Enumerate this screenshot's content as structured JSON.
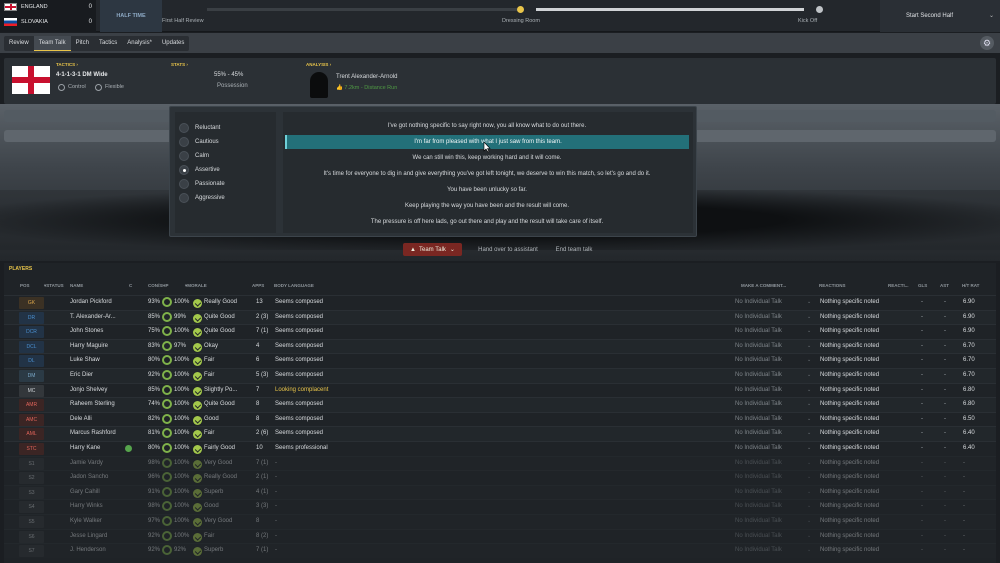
{
  "scoreboard": {
    "home": {
      "name": "ENGLAND",
      "score": "0"
    },
    "away": {
      "name": "SLOVAKIA",
      "score": "0"
    },
    "period": "HALF TIME"
  },
  "timeline": {
    "first_half_review": "First Half Review",
    "dressing_room": "Dressing Room",
    "kick_off": "Kick Off"
  },
  "start_button": {
    "label": "Start Second Half"
  },
  "nav": {
    "tabs": [
      "Review",
      "Team Talk",
      "Pitch",
      "Tactics",
      "Analysis*",
      "Updates"
    ],
    "active": "Team Talk"
  },
  "info": {
    "tactics_header": "TACTICS ›",
    "formation": "4-1-1-3-1 DM Wide",
    "mentality": "Control",
    "shape": "Flexible",
    "stats_header": "STATS ›",
    "possession_values": "55%  -  45%",
    "possession_label": "Possession",
    "analysis_header": "ANALYSIS ›",
    "player_name": "Trent Alexander-Arnold",
    "player_stat": "7.2km - Distance Run"
  },
  "tones": [
    "Reluctant",
    "Cautious",
    "Calm",
    "Assertive",
    "Passionate",
    "Aggressive"
  ],
  "selected_tone": "Assertive",
  "options": [
    "I've got nothing specific to say right now, you all know what to do out there.",
    "I'm far from pleased with what I just saw from this team.",
    "We can still win this, keep working hard and it will come.",
    "It's time for everyone to dig in and give everything you've got left tonight, we deserve to win this match, so let's go and do it.",
    "You have been unlucky so far.",
    "Keep playing the way you have been and the result will come.",
    "The pressure is off here lads, go out there and play and the result will take care of itself."
  ],
  "selected_option": 1,
  "controls": {
    "team_talk": "Team Talk",
    "hand_over": "Hand over to assistant",
    "end": "End team talk"
  },
  "players_header": "PLAYERS",
  "columns": {
    "pos": "POS",
    "status": "STATUS",
    "name": "NAME",
    "c": "C",
    "condition": "CON/SHP",
    "morale": "MORALE",
    "apps": "APPS",
    "body": "BODY LANGUAGE",
    "make_comment": "MAKE A COMMENT...",
    "reactions": "REACTIONS",
    "reactn": "REACTI...",
    "gls": "GLS",
    "ast": "AST",
    "rating": "H/T RAT"
  },
  "colors": {
    "accent": "#e9c54a",
    "selected": "#237079",
    "gk": "#d9a44a",
    "def": "#4a8fd0",
    "dm": "#7aa8c8",
    "mid": "#d0d4d8",
    "att": "#e0645a"
  },
  "rows": [
    {
      "pos": "GK",
      "name": "Jordan Pickford",
      "con": "93%",
      "shp": "100%",
      "morale": "Really Good",
      "apps": "13",
      "body": "Seems composed",
      "comment": "No Individual Talk",
      "reaction": "Nothing specific noted",
      "gls": "-",
      "ast": "-",
      "rat": "6.90"
    },
    {
      "pos": "DR",
      "name": "T. Alexander-Ar...",
      "con": "85%",
      "shp": "99%",
      "morale": "Quite Good",
      "apps": "2 (3)",
      "body": "Seems composed",
      "comment": "No Individual Talk",
      "reaction": "Nothing specific noted",
      "gls": "-",
      "ast": "-",
      "rat": "6.90"
    },
    {
      "pos": "DCR",
      "name": "John Stones",
      "con": "75%",
      "shp": "100%",
      "morale": "Quite Good",
      "apps": "7 (1)",
      "body": "Seems composed",
      "comment": "No Individual Talk",
      "reaction": "Nothing specific noted",
      "gls": "-",
      "ast": "-",
      "rat": "6.90"
    },
    {
      "pos": "DCL",
      "name": "Harry Maguire",
      "con": "83%",
      "shp": "97%",
      "morale": "Okay",
      "apps": "4",
      "body": "Seems composed",
      "comment": "No Individual Talk",
      "reaction": "Nothing specific noted",
      "gls": "-",
      "ast": "-",
      "rat": "6.70"
    },
    {
      "pos": "DL",
      "name": "Luke Shaw",
      "con": "80%",
      "shp": "100%",
      "morale": "Fair",
      "apps": "6",
      "body": "Seems composed",
      "comment": "No Individual Talk",
      "reaction": "Nothing specific noted",
      "gls": "-",
      "ast": "-",
      "rat": "6.70"
    },
    {
      "pos": "DM",
      "name": "Eric Dier",
      "con": "92%",
      "shp": "100%",
      "morale": "Fair",
      "apps": "5 (3)",
      "body": "Seems composed",
      "comment": "No Individual Talk",
      "reaction": "Nothing specific noted",
      "gls": "-",
      "ast": "-",
      "rat": "6.70"
    },
    {
      "pos": "MC",
      "name": "Jonjo Shelvey",
      "con": "85%",
      "shp": "100%",
      "morale": "Slightly Po...",
      "apps": "7",
      "body": "Looking complacent",
      "comment": "No Individual Talk",
      "reaction": "Nothing specific noted",
      "gls": "-",
      "ast": "-",
      "rat": "6.80"
    },
    {
      "pos": "AMR",
      "name": "Raheem Sterling",
      "con": "74%",
      "shp": "100%",
      "morale": "Quite Good",
      "apps": "8",
      "body": "Seems composed",
      "comment": "No Individual Talk",
      "reaction": "Nothing specific noted",
      "gls": "-",
      "ast": "-",
      "rat": "6.80"
    },
    {
      "pos": "AMC",
      "name": "Dele Alli",
      "con": "82%",
      "shp": "100%",
      "morale": "Good",
      "apps": "8",
      "body": "Seems composed",
      "comment": "No Individual Talk",
      "reaction": "Nothing specific noted",
      "gls": "-",
      "ast": "-",
      "rat": "6.50"
    },
    {
      "pos": "AML",
      "name": "Marcus Rashford",
      "con": "81%",
      "shp": "100%",
      "morale": "Fair",
      "apps": "2 (6)",
      "body": "Seems composed",
      "comment": "No Individual Talk",
      "reaction": "Nothing specific noted",
      "gls": "-",
      "ast": "-",
      "rat": "6.40"
    },
    {
      "pos": "STC",
      "name": "Harry Kane",
      "con": "80%",
      "shp": "100%",
      "morale": "Fairly Good",
      "apps": "10",
      "body": "Seems professional",
      "comment": "No Individual Talk",
      "reaction": "Nothing specific noted",
      "gls": "-",
      "ast": "-",
      "rat": "6.40"
    },
    {
      "pos": "S1",
      "name": "Jamie Vardy",
      "con": "98%",
      "shp": "100%",
      "morale": "Very Good",
      "apps": "7 (1)",
      "body": "-",
      "comment": "No Individual Talk",
      "reaction": "Nothing specific noted",
      "gls": "-",
      "ast": "-",
      "rat": "-"
    },
    {
      "pos": "S2",
      "name": "Jadon Sancho",
      "con": "96%",
      "shp": "100%",
      "morale": "Really Good",
      "apps": "2 (1)",
      "body": "-",
      "comment": "No Individual Talk",
      "reaction": "Nothing specific noted",
      "gls": "-",
      "ast": "-",
      "rat": "-"
    },
    {
      "pos": "S3",
      "name": "Gary Cahill",
      "con": "91%",
      "shp": "100%",
      "morale": "Superb",
      "apps": "4 (1)",
      "body": "-",
      "comment": "No Individual Talk",
      "reaction": "Nothing specific noted",
      "gls": "-",
      "ast": "-",
      "rat": "-"
    },
    {
      "pos": "S4",
      "name": "Harry Winks",
      "con": "98%",
      "shp": "100%",
      "morale": "Good",
      "apps": "3 (3)",
      "body": "-",
      "comment": "No Individual Talk",
      "reaction": "Nothing specific noted",
      "gls": "-",
      "ast": "-",
      "rat": "-"
    },
    {
      "pos": "S5",
      "name": "Kyle Walker",
      "con": "97%",
      "shp": "100%",
      "morale": "Very Good",
      "apps": "8",
      "body": "-",
      "comment": "No Individual Talk",
      "reaction": "Nothing specific noted",
      "gls": "-",
      "ast": "-",
      "rat": "-"
    },
    {
      "pos": "S6",
      "name": "Jesse Lingard",
      "con": "92%",
      "shp": "100%",
      "morale": "Fair",
      "apps": "8 (2)",
      "body": "-",
      "comment": "No Individual Talk",
      "reaction": "Nothing specific noted",
      "gls": "-",
      "ast": "-",
      "rat": "-"
    },
    {
      "pos": "S7",
      "name": "J. Henderson",
      "con": "92%",
      "shp": "92%",
      "morale": "Superb",
      "apps": "7 (1)",
      "body": "-",
      "comment": "No Individual Talk",
      "reaction": "Nothing specific noted",
      "gls": "-",
      "ast": "-",
      "rat": "-"
    }
  ]
}
